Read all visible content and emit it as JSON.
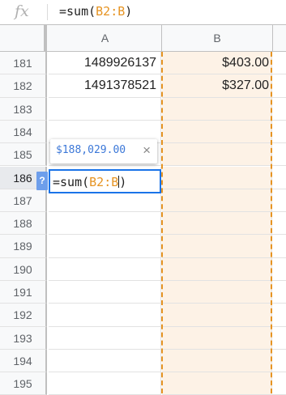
{
  "formula_bar": {
    "fx_label": "fx",
    "prefix": "=sum(",
    "range": "B2:B",
    "suffix": ")"
  },
  "columns": {
    "a": "A",
    "b": "B"
  },
  "rows": [
    {
      "num": "181",
      "a": "1489926137",
      "b": "$403.00"
    },
    {
      "num": "182",
      "a": "1491378521",
      "b": "$327.00"
    },
    {
      "num": "183",
      "a": "",
      "b": ""
    },
    {
      "num": "184",
      "a": "",
      "b": ""
    },
    {
      "num": "185",
      "a": "",
      "b": ""
    },
    {
      "num": "186",
      "a": "",
      "b": ""
    },
    {
      "num": "187",
      "a": "",
      "b": ""
    },
    {
      "num": "188",
      "a": "",
      "b": ""
    },
    {
      "num": "189",
      "a": "",
      "b": ""
    },
    {
      "num": "190",
      "a": "",
      "b": ""
    },
    {
      "num": "191",
      "a": "",
      "b": ""
    },
    {
      "num": "192",
      "a": "",
      "b": ""
    },
    {
      "num": "193",
      "a": "",
      "b": ""
    },
    {
      "num": "194",
      "a": "",
      "b": ""
    },
    {
      "num": "195",
      "a": "",
      "b": ""
    }
  ],
  "tooltip": {
    "value": "$188,029.00",
    "close_glyph": "×"
  },
  "help_badge": "?",
  "editor": {
    "prefix": "=sum(",
    "range_before_cursor": "B2:B",
    "suffix": ")"
  },
  "colors": {
    "range_reference": "#e69423",
    "range_fill": "#fdf2e6",
    "active_border": "#1a73e8",
    "tooltip_value": "#3c78d8"
  },
  "icons": {
    "formula": "fx-icon",
    "help": "help-icon",
    "close": "close-icon"
  }
}
